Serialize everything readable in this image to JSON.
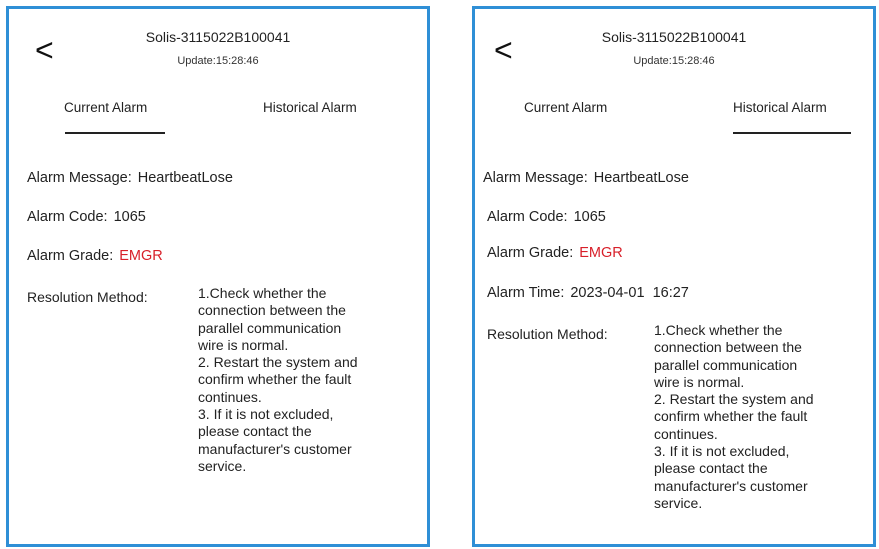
{
  "screens": [
    {
      "back_icon": "<",
      "title": "Solis-3115022B100041",
      "update": "Update:15:28:46",
      "tabs": {
        "current": "Current Alarm",
        "historical": "Historical Alarm"
      },
      "active_tab": "current",
      "alarm": {
        "message_label": "Alarm Message:",
        "message_value": "HeartbeatLose",
        "code_label": "Alarm Code:",
        "code_value": "1065",
        "grade_label": "Alarm Grade:",
        "grade_value": "EMGR",
        "resolution_label": "Resolution Method:",
        "resolution_lines": [
          "1.Check whether the",
          "connection between the",
          "parallel communication",
          "wire is normal.",
          "2. Restart the system and",
          "confirm whether the fault",
          "continues.",
          "3. If it is not excluded,",
          "please contact the",
          "manufacturer's customer",
          "service."
        ]
      }
    },
    {
      "back_icon": "<",
      "title": "Solis-3115022B100041",
      "update": "Update:15:28:46",
      "tabs": {
        "current": "Current Alarm",
        "historical": "Historical Alarm"
      },
      "active_tab": "historical",
      "alarm": {
        "message_label": "Alarm Message:",
        "message_value": "HeartbeatLose",
        "code_label": "Alarm Code:",
        "code_value": "1065",
        "grade_label": "Alarm Grade:",
        "grade_value": "EMGR",
        "time_label": "Alarm Time:",
        "time_value": "2023-04-01  16:27",
        "resolution_label": "Resolution Method:",
        "resolution_lines": [
          "1.Check whether the",
          "connection between the",
          "parallel communication",
          "wire is normal.",
          "2. Restart the system and",
          "confirm whether the fault",
          "continues.",
          "3. If it is not excluded,",
          "please contact the",
          "manufacturer's customer",
          "service."
        ]
      }
    }
  ],
  "colors": {
    "frame": "#2f8fd6",
    "grade": "#d8202a",
    "text": "#222222"
  }
}
